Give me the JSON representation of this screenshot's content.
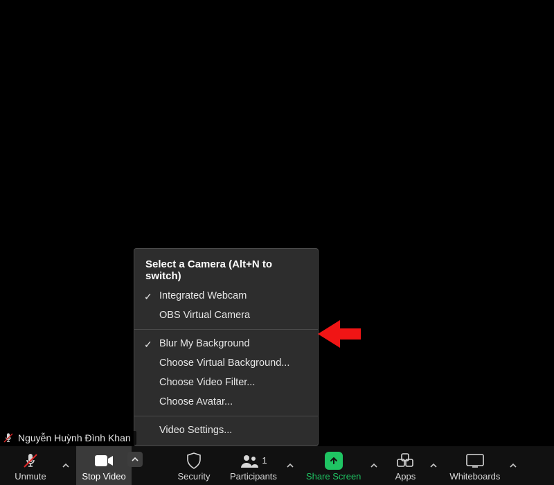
{
  "participant": {
    "name": "Nguyễn Huỳnh Đình Khan"
  },
  "toolbar": {
    "unmute_label": "Unmute",
    "stop_video_label": "Stop Video",
    "security_label": "Security",
    "participants_label": "Participants",
    "participants_count": "1",
    "share_screen_label": "Share Screen",
    "apps_label": "Apps",
    "whiteboards_label": "Whiteboards"
  },
  "camera_menu": {
    "header": "Select a Camera (Alt+N to switch)",
    "integrated_webcam": "Integrated Webcam",
    "obs_virtual_camera": "OBS Virtual Camera",
    "blur_my_background": "Blur My Background",
    "choose_virtual_background": "Choose Virtual Background...",
    "choose_video_filter": "Choose Video Filter...",
    "choose_avatar": "Choose Avatar...",
    "video_settings": "Video Settings..."
  }
}
